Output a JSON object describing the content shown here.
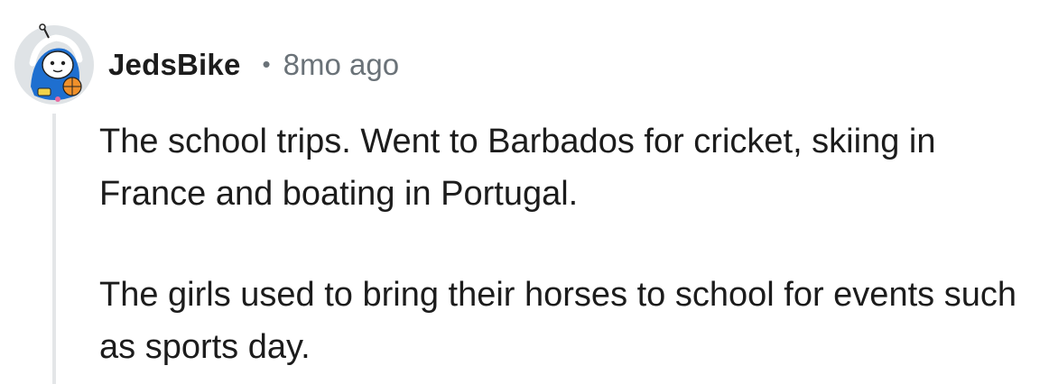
{
  "comment": {
    "author": "JedsBike",
    "separator": "•",
    "timestamp": "8mo ago",
    "avatar_icon": "snoo-avatar-icon",
    "paragraphs": [
      "The school trips. Went to Barbados for cricket, skiing in France and boating in Portugal.",
      "The girls used to bring their horses to school for events such as sports day."
    ]
  },
  "colors": {
    "text": "#1c1c1c",
    "meta": "#6a7278",
    "thread_line": "#e4e6e8"
  }
}
